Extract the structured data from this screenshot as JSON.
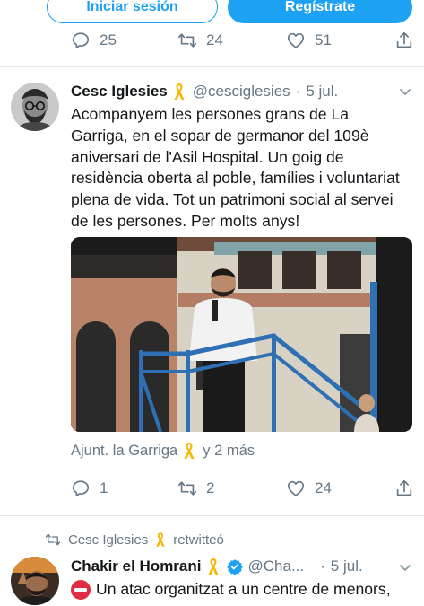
{
  "auth": {
    "login_label": "Iniciar sesión",
    "signup_label": "Regístrate"
  },
  "prev_tweet": {
    "replies": "25",
    "retweets": "24",
    "likes": "51"
  },
  "tweet": {
    "author_name": "Cesc Iglesies",
    "author_handle": "@cesciglesies",
    "separator": "·",
    "date": "5 jul.",
    "text": "Acompanyem les persones grans de  La\nGarriga, en el sopar de germanor del 109è\naniversari de l'Asil Hospital. Un goig de\nresidència oberta al poble, famílies i voluntariat\nplena de vida. Tot un patrimoni social al servei\nde les persones. Per molts anys!",
    "liked_by_name": "Ajunt. la Garriga",
    "liked_by_more": "y 2 más",
    "replies": "1",
    "retweets": "2",
    "likes": "24"
  },
  "retweet_notice": {
    "who": "Cesc Iglesies",
    "action": "retwitteó"
  },
  "tweet2": {
    "author_name": "Chakir el Homrani",
    "author_handle": "@Cha...",
    "separator": "·",
    "date": "5 jul.",
    "text": "Un atac organitzat a un centre de menors,"
  },
  "colors": {
    "accent": "#1da1f2",
    "muted": "#657786",
    "ribbon": "#f5b700",
    "no_entry": "#dd2e44"
  },
  "icons": [
    "reply-icon",
    "retweet-icon",
    "like-icon",
    "share-icon",
    "yellow-ribbon-icon",
    "verified-icon",
    "chevron-down-icon",
    "no-entry-icon"
  ]
}
